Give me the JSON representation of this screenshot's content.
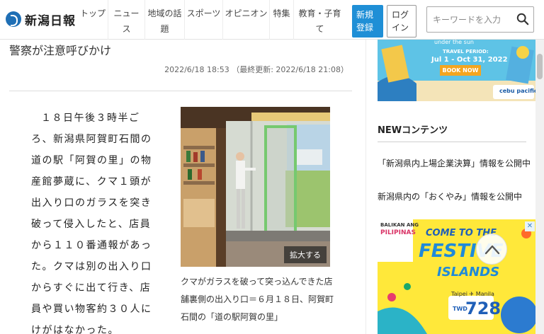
{
  "header": {
    "logo_text": "新潟日報",
    "nav": [
      "トップ",
      "ニュース",
      "地域の話題",
      "スポーツ",
      "オピニオン",
      "特集",
      "教育・子育て"
    ],
    "register_label": "新規登録",
    "login_label": "ログイン",
    "search_placeholder": "キーワードを入力"
  },
  "article": {
    "headline_tail": "警察が注意呼びかけ",
    "timestamp": "2022/6/18 18:53 （最終更新: 2022/6/18 21:08）",
    "body": "１８日午後３時半ごろ、新潟県阿賀町石間の道の駅「阿賀の里」の物産館夢蔵に、クマ１頭が出入り口のガラスを突き破って侵入したと、店員から１１０番通報があった。クマは別の出入り口からすぐに出て行き、店員や買い物客約３０人にけがはなかった。",
    "photo_enlarge_label": "拡大する",
    "caption": "クマがガラスを破って突っ込んできた店舗裏側の出入り口＝６月１８日、阿賀町石間の「道の駅阿賀の里」"
  },
  "sidebar": {
    "ad_top": {
      "small_text": "under the sun",
      "period_label": "TRAVEL PERIOD:",
      "period": "Jul 1 - Oct 31, 2022",
      "cta": "BOOK NOW",
      "brand": "cebu pacific"
    },
    "heading": "NEWコンテンツ",
    "links": [
      "「新潟県内上場企業決算」情報を公開中",
      "新潟県内の「おくやみ」情報を公開中"
    ],
    "ad_bottom": {
      "tagline_1": "BALIKAN ANG",
      "tagline_2": "PILIPINAS",
      "headline_1": "COME TO THE",
      "headline_2": "FESTIVE",
      "headline_3": "ISLANDS",
      "route": "Taipei ✈ Manila",
      "price_prefix": "TWD",
      "price": "728"
    }
  },
  "colors": {
    "accent": "#1f8fd6",
    "logo_blue": "#1f6fb5"
  }
}
